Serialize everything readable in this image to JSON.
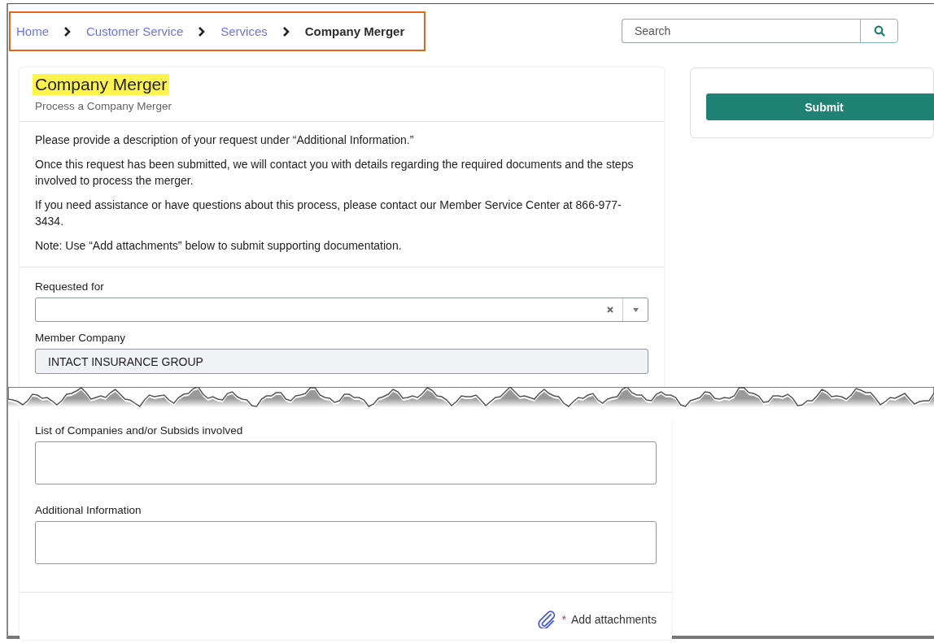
{
  "breadcrumb": [
    {
      "label": "Home",
      "current": false
    },
    {
      "label": "Customer Service",
      "current": false
    },
    {
      "label": "Services",
      "current": false
    },
    {
      "label": "Company Merger",
      "current": true
    }
  ],
  "search": {
    "placeholder": "Search"
  },
  "form": {
    "title": "Company Merger",
    "subtitle": "Process a Company Merger",
    "intro": [
      "Please provide a description of your request under “Additional Information.”",
      "Once this request has been submitted, we will contact you with details regarding the required documents and the steps involved to process the merger.",
      "If you need assistance or have questions about this process, please contact our Member Service Center at 866-977-3434.",
      "Note: Use “Add attachments” below to submit supporting documentation."
    ],
    "fields_before_break": [
      {
        "kind": "select",
        "label": "Requested for"
      },
      {
        "kind": "readonly",
        "label": "Member Company",
        "value": "INTACT INSURANCE GROUP"
      }
    ],
    "fields_after_break": [
      {
        "kind": "textarea",
        "label": "List of Companies and/or Subsids involved"
      },
      {
        "kind": "textarea",
        "label": "Additional Information"
      }
    ],
    "attachments": {
      "required_mark": "*",
      "label": "Add attachments"
    }
  },
  "submit": {
    "label": "Submit"
  }
}
